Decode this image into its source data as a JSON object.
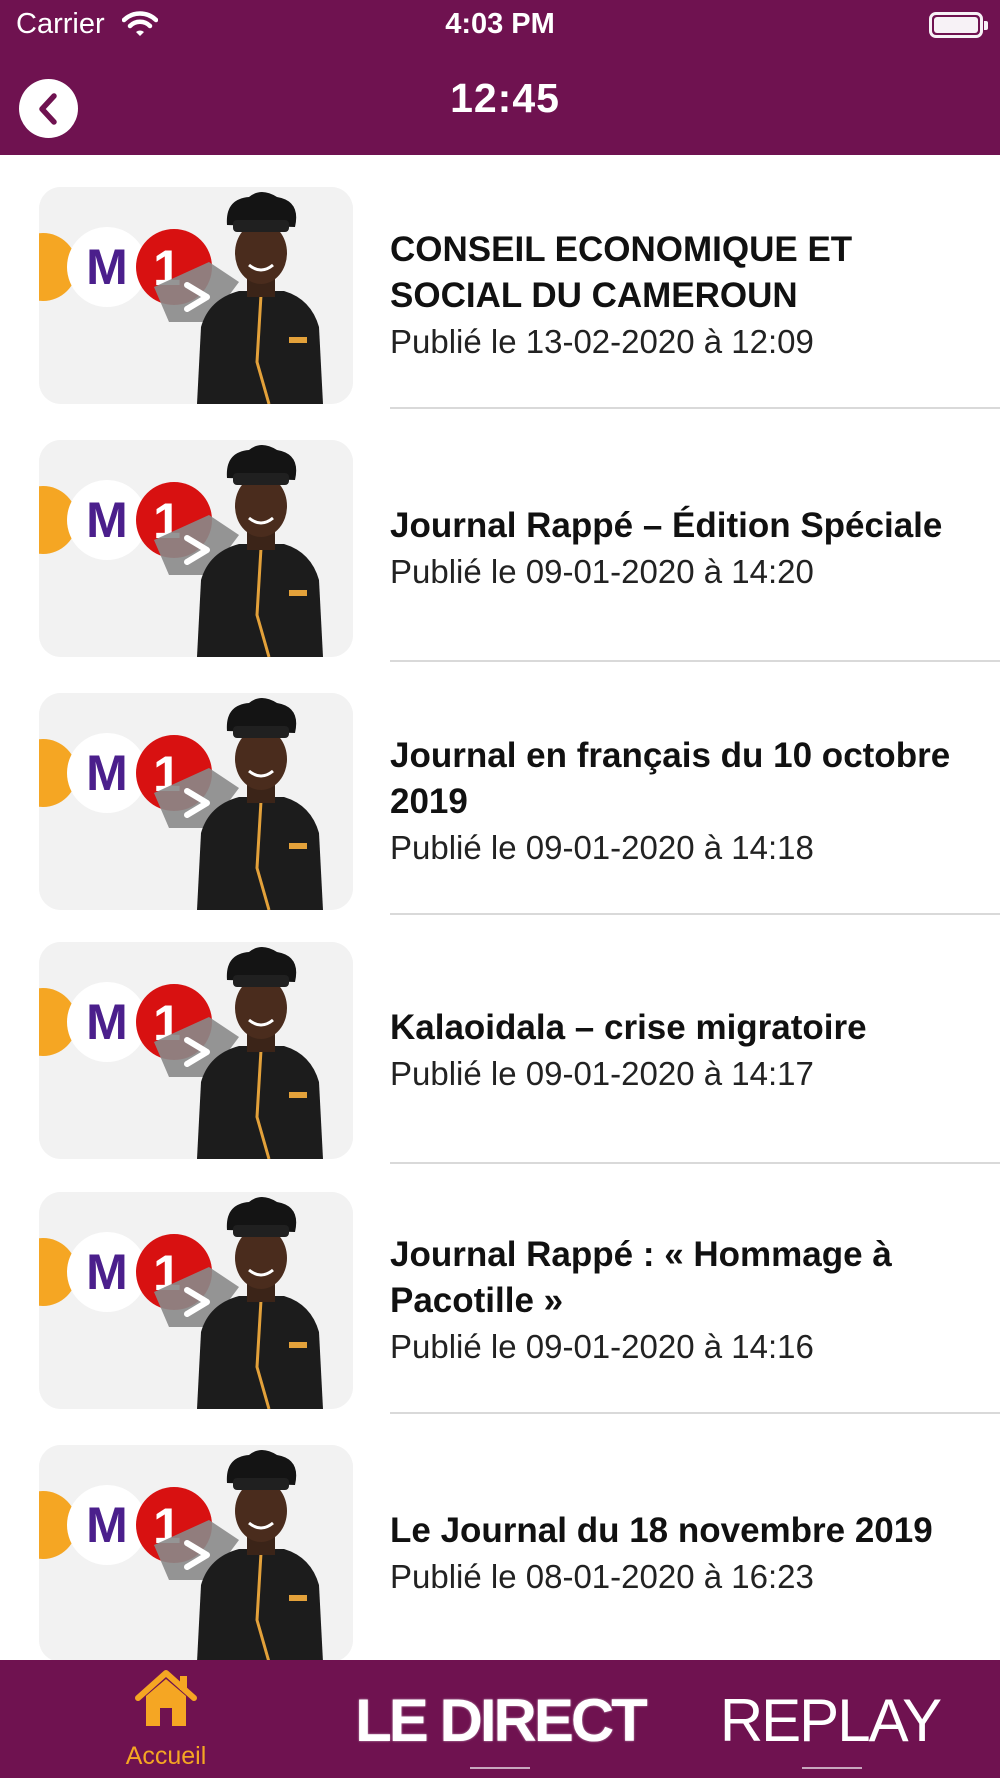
{
  "status_bar": {
    "carrier": "Carrier",
    "time": "4:03 PM"
  },
  "nav": {
    "title": "12:45"
  },
  "videos": [
    {
      "title": "CONSEIL ECONOMIQUE ET SOCIAL DU CAMEROUN",
      "date": "Publié le 13-02-2020 à 12:09"
    },
    {
      "title": "Journal Rappé – Édition Spéciale",
      "date": "Publié le 09-01-2020 à 14:20"
    },
    {
      "title": "Journal en français du 10 octobre 2019",
      "date": "Publié le 09-01-2020 à 14:18"
    },
    {
      "title": "Kalaoidala – crise migratoire",
      "date": "Publié le 09-01-2020 à 14:17"
    },
    {
      "title": "Journal Rappé : « Hommage à Pacotille »",
      "date": "Publié le 09-01-2020 à 14:16"
    },
    {
      "title": "Le Journal du 18 novembre 2019",
      "date": "Publié le 08-01-2020 à 16:23"
    }
  ],
  "thumbnail_logo": {
    "letter": "M",
    "digit": "1"
  },
  "tab_bar": {
    "home_label": "Accueil",
    "live_label": "LE DIRECT",
    "replay_label": "REPLAY"
  },
  "colors": {
    "brand": "#6f1250",
    "accent": "#f5a623"
  }
}
